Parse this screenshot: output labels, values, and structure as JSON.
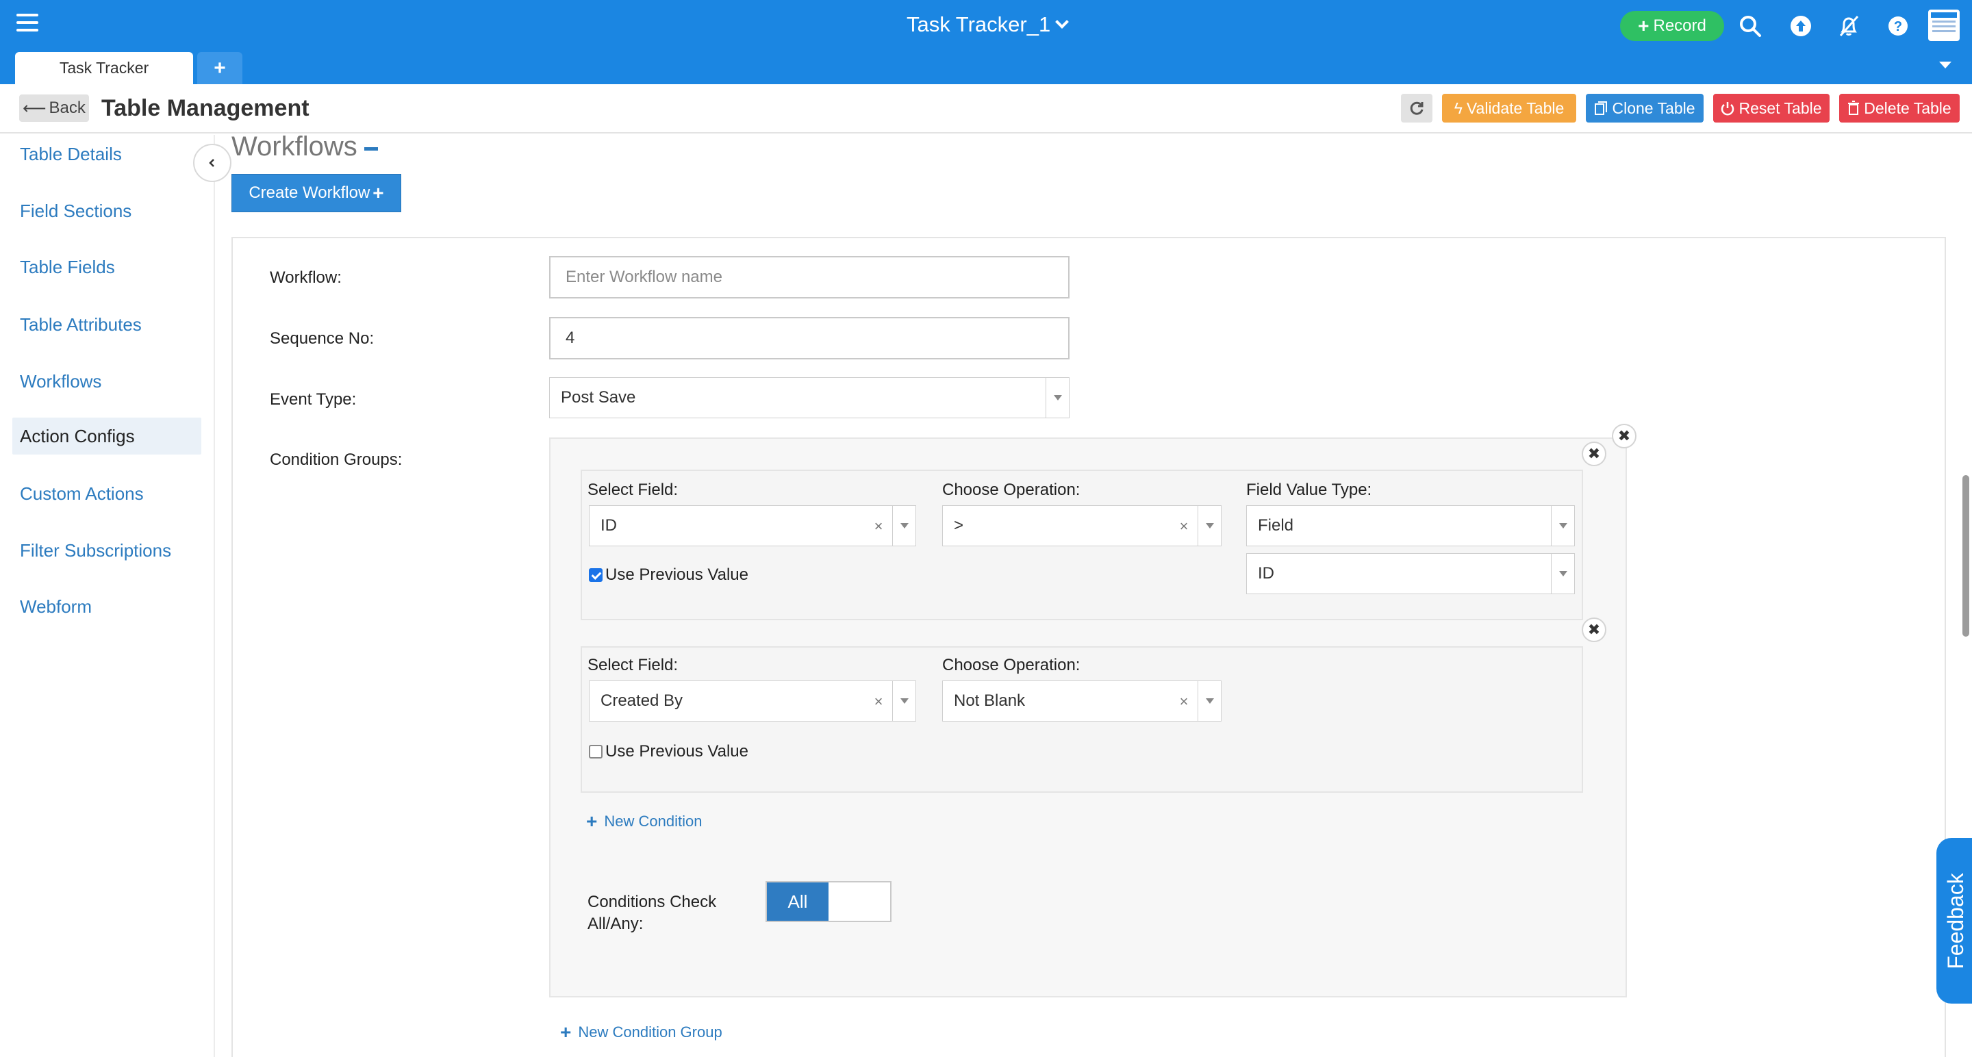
{
  "topbar": {
    "app_title": "Task Tracker_1",
    "record_label": "Record",
    "tabs": [
      {
        "label": "Task Tracker"
      }
    ],
    "icons": [
      "hamburger-icon",
      "search-icon",
      "upload-icon",
      "bell-off-icon",
      "help-icon",
      "app-thumbnail-icon"
    ]
  },
  "header": {
    "back_label": "Back",
    "title": "Table Management",
    "validate_label": "Validate Table",
    "clone_label": "Clone Table",
    "reset_label": "Reset Table",
    "delete_label": "Delete Table"
  },
  "sidebar": {
    "items": [
      {
        "label": "Table Details"
      },
      {
        "label": "Field Sections"
      },
      {
        "label": "Table Fields"
      },
      {
        "label": "Table Attributes"
      },
      {
        "label": "Workflows"
      },
      {
        "label": "Action Configs"
      },
      {
        "label": "Custom Actions"
      },
      {
        "label": "Filter Subscriptions"
      },
      {
        "label": "Webform"
      }
    ],
    "active": "Action Configs"
  },
  "content": {
    "heading": "Workflows",
    "create_label": "Create Workflow",
    "form": {
      "workflow_label": "Workflow:",
      "workflow_placeholder": "Enter Workflow name",
      "sequence_label": "Sequence No:",
      "sequence_value": "4",
      "event_label": "Event Type:",
      "event_value": "Post Save",
      "condition_groups_label": "Condition Groups:"
    },
    "conditions": [
      {
        "select_field_label": "Select Field:",
        "select_field_value": "ID",
        "operation_label": "Choose Operation:",
        "operation_value": ">",
        "value_type_label": "Field Value Type:",
        "value_type_value": "Field",
        "value_field_value": "ID",
        "use_previous_label": "Use Previous Value",
        "use_previous_checked": true
      },
      {
        "select_field_label": "Select Field:",
        "select_field_value": "Created By",
        "operation_label": "Choose Operation:",
        "operation_value": "Not Blank",
        "use_previous_label": "Use Previous Value",
        "use_previous_checked": false
      }
    ],
    "new_condition_label": "New Condition",
    "check_label": "Conditions Check All/Any:",
    "check_value": "All",
    "new_condition_group_label": "New Condition Group"
  },
  "feedback_label": "Feedback",
  "colors": {
    "brand_blue": "#1b86e2",
    "record_green": "#2fc063",
    "validate_orange": "#f4a640",
    "clone_blue": "#2f8ad8",
    "danger_red": "#e8424d"
  }
}
